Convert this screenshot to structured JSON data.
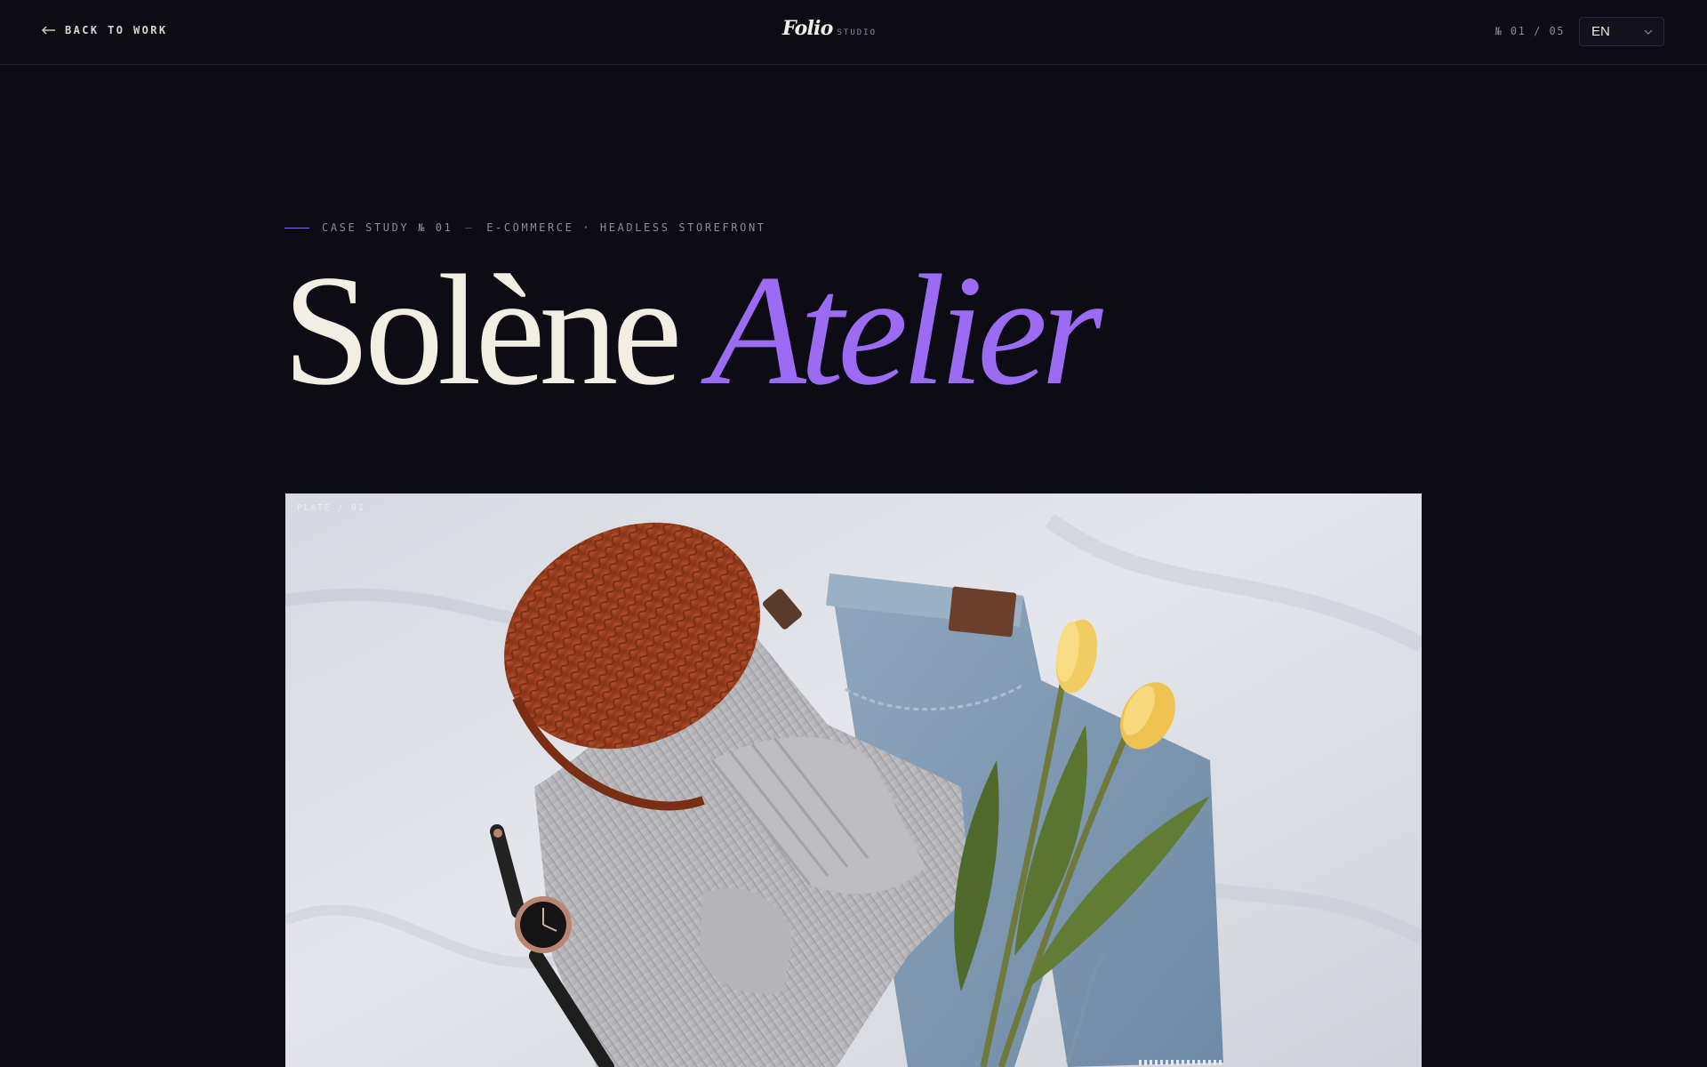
{
  "header": {
    "back_label": "BACK TO WORK",
    "brand_name": "Folio",
    "brand_sub": "STUDIO",
    "counter": "№ 01 / 05",
    "language": {
      "selected": "EN"
    }
  },
  "hero": {
    "eyebrow": {
      "case_label": "CASE STUDY № 01",
      "separator": "—",
      "category": "E-COMMERCE · HEADLESS STOREFRONT"
    },
    "title_main": "Solène",
    "title_accent": "Atelier"
  },
  "plate": {
    "label": "PLATE / 01",
    "subject": "Flat-lay of a rust knit beanie, grey ribbed sweater, light-wash jeans, black leather watch and yellow tulips on white linen"
  },
  "colors": {
    "background": "#0d0b14",
    "accent": "#9b6cf3",
    "title": "#f3eee3",
    "muted": "#8f8a9b"
  },
  "icons": {
    "back": "arrow-left-icon",
    "language": "chevron-down-icon"
  }
}
